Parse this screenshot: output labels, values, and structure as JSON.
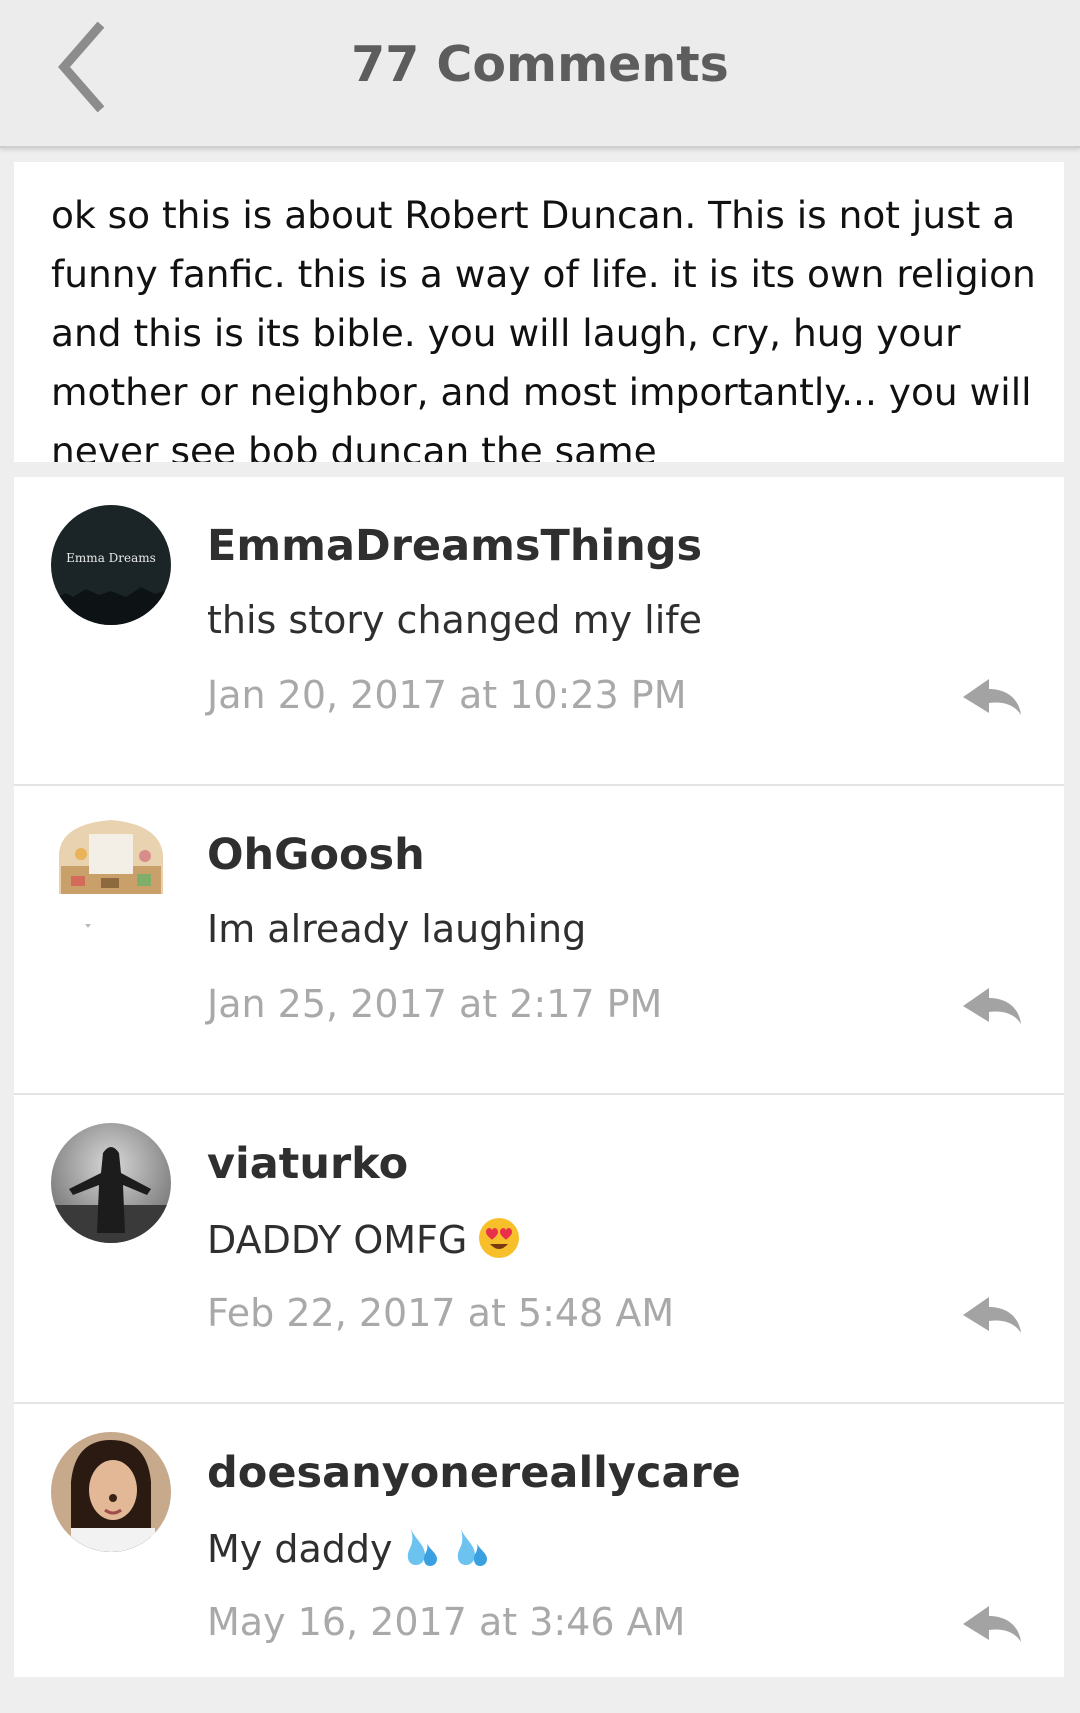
{
  "header": {
    "title": "77 Comments",
    "back_icon": "chevron-left-icon"
  },
  "story": {
    "description": "ok so this is about Robert Duncan. This is not just a funny fanfic. this is a way of life. it is its own religion and this is its bible. you will laugh, cry, hug your mother or neighbor, and most importantly... you will never see bob duncan the same"
  },
  "comments": [
    {
      "username": "EmmaDreamsThings",
      "text": "this story changed my life",
      "timestamp": "Jan 20, 2017 at 10:23 PM",
      "avatar_text": "Emma Dreams",
      "emoji": []
    },
    {
      "username": "OhGoosh",
      "text": "Im already laughing",
      "timestamp": "Jan 25, 2017 at 2:17 PM",
      "emoji": []
    },
    {
      "username": "viaturko",
      "text": "DADDY OMFG",
      "timestamp": "Feb 22, 2017 at 5:48 AM",
      "emoji": [
        "heart-eyes-emoji"
      ]
    },
    {
      "username": "doesanyonereallycare",
      "text": "My daddy",
      "timestamp": "May 16, 2017 at 3:46 AM",
      "emoji": [
        "sweat-droplets-emoji",
        "sweat-droplets-emoji"
      ]
    }
  ],
  "colors": {
    "header_bg": "#ececec",
    "title": "#5d5d5d",
    "username": "#2f2f2f",
    "timestamp": "#a9a9a9",
    "page_bg": "#eeeeee"
  }
}
